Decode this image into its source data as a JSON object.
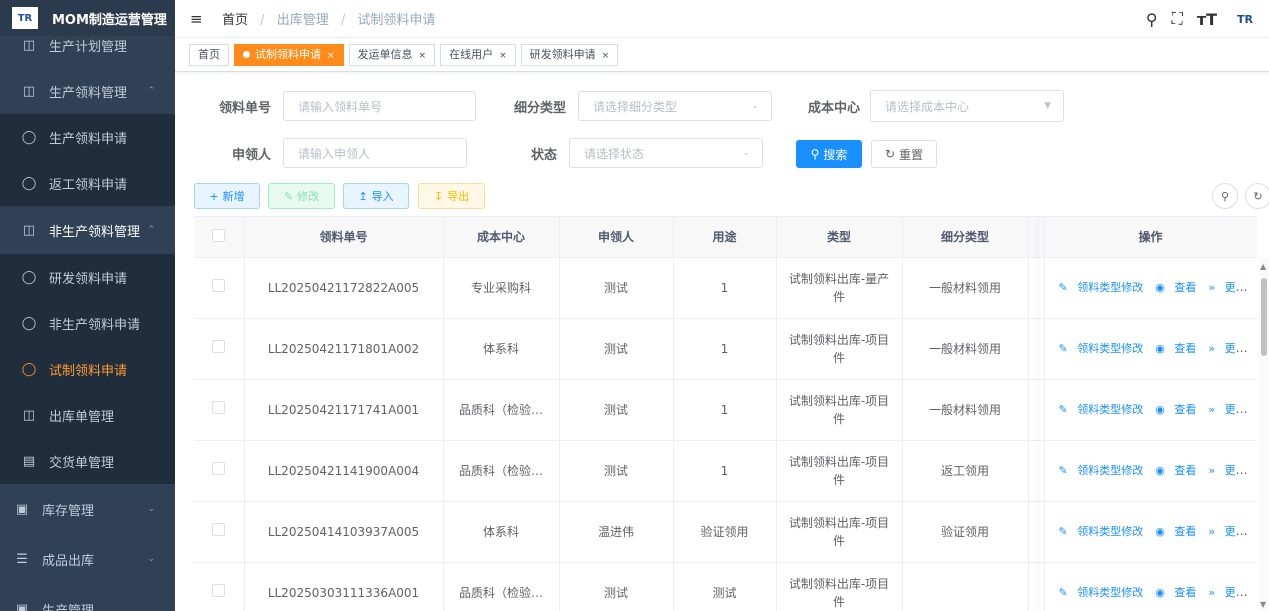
{
  "app": {
    "logo_text": "TR",
    "title": "MOM制造运营管理"
  },
  "sidebar": {
    "items": [
      {
        "label": "生产计划管理",
        "icon": "grid-icon"
      },
      {
        "label": "生产领料管理",
        "icon": "grid-icon"
      },
      {
        "label": "生产领料申请",
        "icon": "bag-icon"
      },
      {
        "label": "返工领料申请",
        "icon": "bag-icon"
      },
      {
        "label": "非生产领料管理",
        "icon": "grid-icon"
      },
      {
        "label": "研发领料申请",
        "icon": "bag-icon"
      },
      {
        "label": "非生产领料申请",
        "icon": "bag-icon"
      },
      {
        "label": "试制领料申请",
        "icon": "bag-icon"
      },
      {
        "label": "出库单管理",
        "icon": "grid-icon"
      },
      {
        "label": "交货单管理",
        "icon": "card-icon"
      },
      {
        "label": "库存管理",
        "icon": "monitor-icon"
      },
      {
        "label": "成品出库",
        "icon": "list-icon"
      },
      {
        "label": "生产管理",
        "icon": "box-icon"
      }
    ],
    "active_color": "#ff9a2e"
  },
  "breadcrumb": {
    "home": "首页",
    "level1": "出库管理",
    "level2": "试制领料申请"
  },
  "tags": [
    {
      "label": "首页"
    },
    {
      "label": "试制领料申请"
    },
    {
      "label": "发运单信息"
    },
    {
      "label": "在线用户"
    },
    {
      "label": "研发领料申请"
    }
  ],
  "search": {
    "order_no_label": "领料单号",
    "order_no_placeholder": "请输入领料单号",
    "subtype_label": "细分类型",
    "subtype_placeholder": "请选择细分类型",
    "cost_center_label": "成本中心",
    "cost_center_placeholder": "请选择成本中心",
    "applicant_label": "申领人",
    "applicant_placeholder": "请输入申领人",
    "status_label": "状态",
    "status_placeholder": "请选择状态",
    "search_button": "搜索",
    "reset_button": "重置"
  },
  "toolbar": {
    "add": "新增",
    "edit": "修改",
    "import": "导入",
    "export": "导出"
  },
  "table": {
    "headers": [
      "领料单号",
      "成本中心",
      "申领人",
      "用途",
      "类型",
      "细分类型",
      "操作"
    ],
    "rows": [
      {
        "no": "LL20250421172822A005",
        "center": "专业采购科",
        "applicant": "测试",
        "purpose": "1",
        "type": "试制领料出库-量产件",
        "subtype": "一般材料领用"
      },
      {
        "no": "LL20250421171801A002",
        "center": "体系科",
        "applicant": "测试",
        "purpose": "1",
        "type": "试制领料出库-项目件",
        "subtype": "一般材料领用"
      },
      {
        "no": "LL20250421171741A001",
        "center": "品质科（检验…",
        "applicant": "测试",
        "purpose": "1",
        "type": "试制领料出库-项目件",
        "subtype": "一般材料领用"
      },
      {
        "no": "LL20250421141900A004",
        "center": "品质科（检验…",
        "applicant": "测试",
        "purpose": "1",
        "type": "试制领料出库-项目件",
        "subtype": "返工领用"
      },
      {
        "no": "LL20250414103937A005",
        "center": "体系科",
        "applicant": "温进伟",
        "purpose": "验证领用",
        "type": "试制领料出库-项目件",
        "subtype": "验证领用"
      },
      {
        "no": "LL20250303111336A001",
        "center": "品质科（检验…",
        "applicant": "测试",
        "purpose": "测试",
        "type": "试制领料出库-项目件",
        "subtype": ""
      }
    ],
    "actions": {
      "modify_type": "领料类型修改",
      "view": "查看",
      "more": "更多"
    }
  }
}
